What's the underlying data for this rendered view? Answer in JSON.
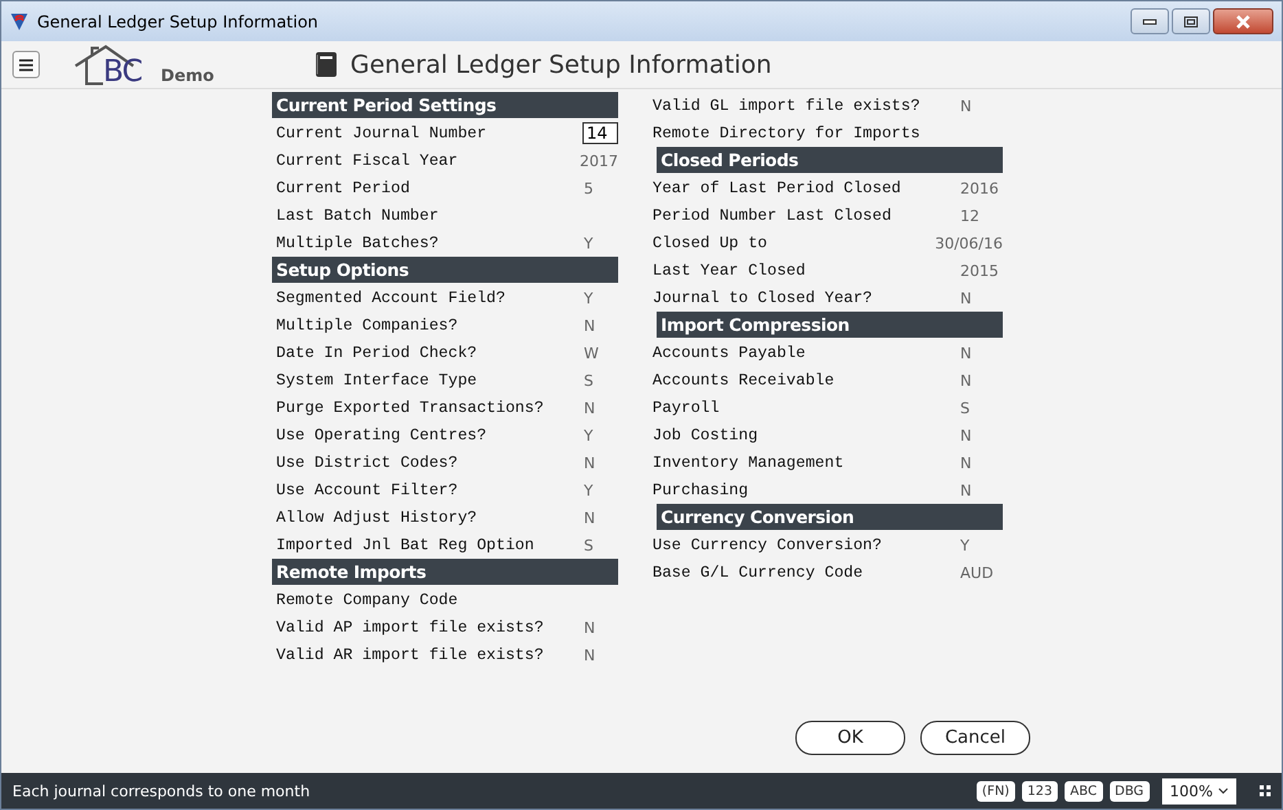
{
  "window": {
    "title": "General Ledger Setup Information"
  },
  "header": {
    "logo_text": "BC",
    "logo_caption": "Demo",
    "title": "General Ledger Setup Information"
  },
  "columns": [
    [
      {
        "kind": "header",
        "label": "Current Period Settings"
      },
      {
        "kind": "input",
        "label": "Current Journal Number",
        "value": "14"
      },
      {
        "kind": "field",
        "label": "Current Fiscal Year",
        "value": "2017"
      },
      {
        "kind": "field",
        "label": "Current Period",
        "value": "5"
      },
      {
        "kind": "field",
        "label": "Last Batch Number"
      },
      {
        "kind": "field",
        "label": "Multiple Batches?",
        "value": "Y"
      },
      {
        "kind": "header",
        "label": "Setup Options"
      },
      {
        "kind": "field",
        "label": "Segmented Account Field?",
        "value": "Y"
      },
      {
        "kind": "field",
        "label": "Multiple Companies?",
        "value": "N"
      },
      {
        "kind": "field",
        "label": "Date In Period Check?",
        "value": "W"
      },
      {
        "kind": "field",
        "label": "System Interface Type",
        "value": "S"
      },
      {
        "kind": "field",
        "label": "Purge Exported Transactions?",
        "value": "N"
      },
      {
        "kind": "field",
        "label": "Use Operating Centres?",
        "value": "Y"
      },
      {
        "kind": "field",
        "label": "Use District Codes?",
        "value": "N"
      },
      {
        "kind": "field",
        "label": "Use Account Filter?",
        "value": "Y"
      },
      {
        "kind": "field",
        "label": "Allow Adjust History?",
        "value": "N"
      },
      {
        "kind": "field",
        "label": "Imported Jnl Bat Reg Option",
        "value": "S"
      },
      {
        "kind": "header",
        "label": "Remote Imports"
      },
      {
        "kind": "field",
        "label": "Remote Company Code"
      },
      {
        "kind": "field",
        "label": "Valid AP import file exists?",
        "value": "N"
      },
      {
        "kind": "field",
        "label": "Valid AR import file exists?",
        "value": "N"
      }
    ],
    [
      {
        "kind": "field",
        "label": "Valid GL import file exists?",
        "value": "N"
      },
      {
        "kind": "field",
        "label": "Remote Directory for Imports"
      },
      {
        "kind": "header",
        "label": "Closed Periods"
      },
      {
        "kind": "field",
        "label": "Year of Last Period Closed",
        "value": "2016"
      },
      {
        "kind": "field",
        "label": "Period Number Last Closed",
        "value": "12"
      },
      {
        "kind": "field",
        "label": "Closed Up to",
        "value": "30/06/16"
      },
      {
        "kind": "field",
        "label": "Last Year Closed",
        "value": "2015"
      },
      {
        "kind": "field",
        "label": "Journal to Closed Year?",
        "value": "N"
      },
      {
        "kind": "header",
        "label": "Import Compression"
      },
      {
        "kind": "field",
        "label": "Accounts Payable",
        "value": "N"
      },
      {
        "kind": "field",
        "label": "Accounts Receivable",
        "value": "N"
      },
      {
        "kind": "field",
        "label": "Payroll",
        "value": "S"
      },
      {
        "kind": "field",
        "label": "Job Costing",
        "value": "N"
      },
      {
        "kind": "field",
        "label": "Inventory Management",
        "value": "N"
      },
      {
        "kind": "field",
        "label": "Purchasing",
        "value": "N"
      },
      {
        "kind": "header",
        "label": "Currency Conversion"
      },
      {
        "kind": "field",
        "label": "Use Currency Conversion?",
        "value": "Y"
      },
      {
        "kind": "field",
        "label": "Base G/L Currency Code",
        "value": "AUD"
      }
    ]
  ],
  "buttons": [
    "OK",
    "Cancel"
  ],
  "status_bar": {
    "message": "Each journal corresponds to one month",
    "modes": [
      "(FN)",
      "123",
      "ABC",
      "DBG"
    ],
    "zoom": "100%"
  }
}
